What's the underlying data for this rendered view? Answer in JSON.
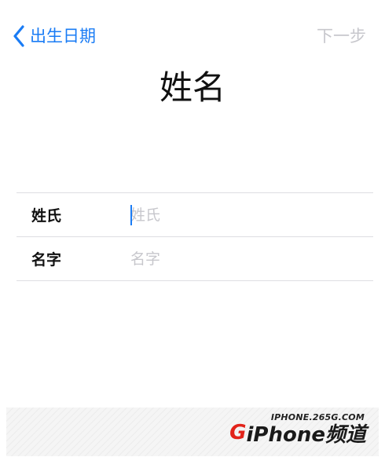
{
  "nav": {
    "back_label": "出生日期",
    "next_label": "下一步"
  },
  "title": "姓名",
  "form": {
    "rows": [
      {
        "label": "姓氏",
        "placeholder": "姓氏",
        "value": ""
      },
      {
        "label": "名字",
        "placeholder": "名字",
        "value": ""
      }
    ]
  },
  "watermark": {
    "url": "IPHONE.265G.COM",
    "logo_g": "G",
    "logo_name": "iPhone频道"
  },
  "colors": {
    "accent": "#1a7cf5",
    "disabled": "#c7c7cc",
    "separator": "#dedee2",
    "logo_red": "#e2231a"
  },
  "icons": {
    "back": "chevron-left-icon"
  }
}
